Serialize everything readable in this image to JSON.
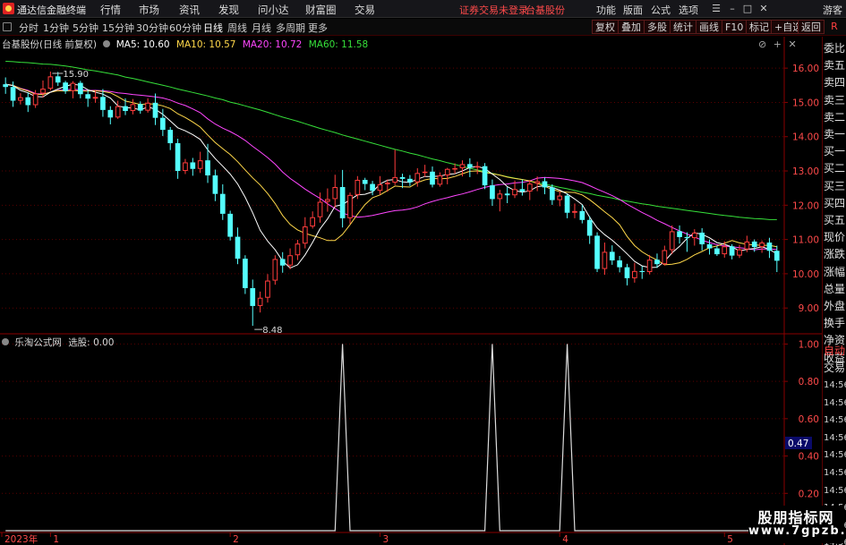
{
  "app": {
    "title": "通达信金融终端"
  },
  "menu": [
    "行情",
    "市场",
    "资讯",
    "发现",
    "问小达",
    "财富圈",
    "交易"
  ],
  "status": {
    "login_warning": "证券交易未登录",
    "stock": "台基股份"
  },
  "right_menu": [
    "功能",
    "版面",
    "公式",
    "选项"
  ],
  "guest": "游客",
  "periods": [
    "分时",
    "1分钟",
    "5分钟",
    "15分钟",
    "30分钟",
    "60分钟",
    "日线",
    "周线",
    "月线",
    "多周期",
    "更多"
  ],
  "active_period": "日线",
  "right_buttons": [
    "复权",
    "叠加",
    "多股",
    "统计",
    "画线",
    "F10",
    "标记",
    "+自选",
    "返回"
  ],
  "corner_label": "R",
  "main_info": {
    "name": "台基股份(日线 前复权)",
    "ma5": "MA5: 10.60",
    "ma10": "MA10: 10.57",
    "ma20": "MA20: 10.72",
    "ma60": "MA60: 11.58"
  },
  "sub_info": {
    "name": "乐淘公式网",
    "value": "选股: 0.00"
  },
  "colors": {
    "up": "#ff3c3c",
    "down": "#54ffff",
    "ma5": "#ffffff",
    "ma10": "#ffd84a",
    "ma20": "#ff46ff",
    "ma60": "#36e03a",
    "signal": "#dcdcdc",
    "axis": "#8a0000",
    "grid": "#5a0000",
    "label_red": "#ff4a4a"
  },
  "side_panel": {
    "top_items": [
      "委比",
      "卖五",
      "卖四",
      "卖三",
      "卖二",
      "卖一",
      "买一",
      "买二",
      "买三",
      "买四",
      "买五",
      "现价",
      "涨跌",
      "涨幅",
      "总量",
      "外盘",
      "换手",
      "净资",
      "收益"
    ],
    "lower_items": [
      "自动",
      "交易"
    ],
    "times": [
      "14:56",
      "14:56",
      "14:56",
      "14:56",
      "14:56",
      "14:56",
      "14:56",
      "14:56",
      "14:56",
      "14:56"
    ]
  },
  "watermark": {
    "top": "股朋指标网",
    "bottom": "www.7gpzb.com"
  },
  "chart_data": [
    {
      "type": "candlestick",
      "ylim": [
        8.3,
        16.5
      ],
      "y_ticks": [
        9.0,
        10.0,
        11.0,
        12.0,
        13.0,
        14.0,
        15.0,
        16.0
      ],
      "y_tick_labels": [
        "9.00",
        "10.00",
        "11.00",
        "12.00",
        "13.00",
        "14.00",
        "15.00",
        "16.00"
      ],
      "x_labels": [
        "2023年",
        "1",
        "2",
        "3",
        "4",
        "5"
      ],
      "x_label_index": [
        0,
        6,
        30,
        50,
        74,
        96
      ],
      "high_label": "15.90",
      "low_label": "8.48",
      "ohlc": [
        [
          15.53,
          15.73,
          15.25,
          15.45
        ],
        [
          15.45,
          15.61,
          14.87,
          15.05
        ],
        [
          15.05,
          15.27,
          14.94,
          15.15
        ],
        [
          15.15,
          15.29,
          14.72,
          14.92
        ],
        [
          14.92,
          15.36,
          14.84,
          15.26
        ],
        [
          15.26,
          15.64,
          15.14,
          15.4
        ],
        [
          15.4,
          15.9,
          15.35,
          15.76
        ],
        [
          15.76,
          15.89,
          15.48,
          15.58
        ],
        [
          15.58,
          15.63,
          15.25,
          15.33
        ],
        [
          15.33,
          15.62,
          15.12,
          15.57
        ],
        [
          15.57,
          15.63,
          15.12,
          15.24
        ],
        [
          15.24,
          15.36,
          14.87,
          15.11
        ],
        [
          15.11,
          15.35,
          14.99,
          15.16
        ],
        [
          15.16,
          15.39,
          14.58,
          14.78
        ],
        [
          14.78,
          14.89,
          14.36,
          14.56
        ],
        [
          14.56,
          15.05,
          14.52,
          14.89
        ],
        [
          14.89,
          15.12,
          14.63,
          14.75
        ],
        [
          14.75,
          15.1,
          14.65,
          14.95
        ],
        [
          14.95,
          15.03,
          14.67,
          14.76
        ],
        [
          14.76,
          15.12,
          14.7,
          14.99
        ],
        [
          14.99,
          15.26,
          14.34,
          14.55
        ],
        [
          14.55,
          14.81,
          14.02,
          14.2
        ],
        [
          14.2,
          14.28,
          13.61,
          13.81
        ],
        [
          13.81,
          13.94,
          12.77,
          13.0
        ],
        [
          13.0,
          13.35,
          12.91,
          13.25
        ],
        [
          13.25,
          13.38,
          12.86,
          13.06
        ],
        [
          13.06,
          13.56,
          12.94,
          13.31
        ],
        [
          13.31,
          13.79,
          12.65,
          12.87
        ],
        [
          12.87,
          13.04,
          12.12,
          12.33
        ],
        [
          12.33,
          12.61,
          11.57,
          11.75
        ],
        [
          11.75,
          11.84,
          10.97,
          11.08
        ],
        [
          11.08,
          11.35,
          10.28,
          10.44
        ],
        [
          10.44,
          10.54,
          9.41,
          9.58
        ],
        [
          9.58,
          9.83,
          8.48,
          9.06
        ],
        [
          9.06,
          9.48,
          8.87,
          9.3
        ],
        [
          9.3,
          9.99,
          9.16,
          9.8
        ],
        [
          9.8,
          10.54,
          9.68,
          10.43
        ],
        [
          10.43,
          10.63,
          10.03,
          10.24
        ],
        [
          10.24,
          10.74,
          10.13,
          10.54
        ],
        [
          10.54,
          10.99,
          10.4,
          10.88
        ],
        [
          10.88,
          11.65,
          10.74,
          11.38
        ],
        [
          11.38,
          11.82,
          11.32,
          11.65
        ],
        [
          11.65,
          12.37,
          11.49,
          12.1
        ],
        [
          12.1,
          12.49,
          11.81,
          12.18
        ],
        [
          12.18,
          12.89,
          11.93,
          12.53
        ],
        [
          12.53,
          13.03,
          11.35,
          11.62
        ],
        [
          11.62,
          12.37,
          11.46,
          12.3
        ],
        [
          12.3,
          12.85,
          12.18,
          12.74
        ],
        [
          12.74,
          12.8,
          12.44,
          12.62
        ],
        [
          12.62,
          12.71,
          12.29,
          12.42
        ],
        [
          12.42,
          12.85,
          12.31,
          12.61
        ],
        [
          12.61,
          12.75,
          12.39,
          12.66
        ],
        [
          12.66,
          13.62,
          12.59,
          12.82
        ],
        [
          12.82,
          12.92,
          12.5,
          12.77
        ],
        [
          12.77,
          12.88,
          12.56,
          12.67
        ],
        [
          12.67,
          13.08,
          12.54,
          12.94
        ],
        [
          12.94,
          13.18,
          12.83,
          12.98
        ],
        [
          12.98,
          13.13,
          12.52,
          12.6
        ],
        [
          12.6,
          12.96,
          12.54,
          12.87
        ],
        [
          12.87,
          13.09,
          12.61,
          13.06
        ],
        [
          13.06,
          13.22,
          12.92,
          13.08
        ],
        [
          13.08,
          13.31,
          12.84,
          13.2
        ],
        [
          13.2,
          13.37,
          12.82,
          13.1
        ],
        [
          13.1,
          13.27,
          12.91,
          13.14
        ],
        [
          13.14,
          13.23,
          12.47,
          12.58
        ],
        [
          12.58,
          12.75,
          11.98,
          12.18
        ],
        [
          12.18,
          12.45,
          11.82,
          12.34
        ],
        [
          12.34,
          12.53,
          12.06,
          12.29
        ],
        [
          12.29,
          12.72,
          12.21,
          12.47
        ],
        [
          12.47,
          12.75,
          12.28,
          12.4
        ],
        [
          12.4,
          12.74,
          12.15,
          12.63
        ],
        [
          12.63,
          12.84,
          12.41,
          12.7
        ],
        [
          12.7,
          12.81,
          12.32,
          12.52
        ],
        [
          12.52,
          12.61,
          12.01,
          12.15
        ],
        [
          12.15,
          12.41,
          11.97,
          12.28
        ],
        [
          12.28,
          12.33,
          11.62,
          11.78
        ],
        [
          11.78,
          12.05,
          11.62,
          11.83
        ],
        [
          11.83,
          12.01,
          11.47,
          11.57
        ],
        [
          11.57,
          11.68,
          10.87,
          11.11
        ],
        [
          11.11,
          11.21,
          10.05,
          10.14
        ],
        [
          10.14,
          10.91,
          9.97,
          10.64
        ],
        [
          10.64,
          10.83,
          10.26,
          10.39
        ],
        [
          10.39,
          10.52,
          10.04,
          10.19
        ],
        [
          10.19,
          10.29,
          9.66,
          9.87
        ],
        [
          9.87,
          10.32,
          9.74,
          10.08
        ],
        [
          10.08,
          10.22,
          9.85,
          10.05
        ],
        [
          10.05,
          10.55,
          9.98,
          10.41
        ],
        [
          10.41,
          10.59,
          10.17,
          10.28
        ],
        [
          10.28,
          10.82,
          10.24,
          10.69
        ],
        [
          10.69,
          11.41,
          10.57,
          11.24
        ],
        [
          11.24,
          11.41,
          10.88,
          11.07
        ],
        [
          11.07,
          11.21,
          10.64,
          11.04
        ],
        [
          11.04,
          11.3,
          10.82,
          11.2
        ],
        [
          11.2,
          11.33,
          10.68,
          10.86
        ],
        [
          10.86,
          11.0,
          10.56,
          10.74
        ],
        [
          10.74,
          10.81,
          10.52,
          10.57
        ],
        [
          10.57,
          10.95,
          10.47,
          10.8
        ],
        [
          10.8,
          10.86,
          10.42,
          10.53
        ],
        [
          10.53,
          10.85,
          10.46,
          10.71
        ],
        [
          10.71,
          11.11,
          10.63,
          10.94
        ],
        [
          10.94,
          11.0,
          10.64,
          10.78
        ],
        [
          10.78,
          10.97,
          10.61,
          10.91
        ],
        [
          10.91,
          11.05,
          10.46,
          10.67
        ],
        [
          10.67,
          10.82,
          10.05,
          10.38
        ]
      ],
      "ma5": [
        15.53,
        15.49,
        15.35,
        15.28,
        15.17,
        15.16,
        15.3,
        15.39,
        15.47,
        15.53,
        15.5,
        15.37,
        15.3,
        15.24,
        15.13,
        14.9,
        14.85,
        14.84,
        14.78,
        14.87,
        14.8,
        14.65,
        14.46,
        14.26,
        14.17,
        14.06,
        13.92,
        13.62,
        13.36,
        13.14,
        12.91,
        12.62,
        12.23,
        11.78,
        11.27,
        10.95,
        10.7,
        10.37,
        10.17,
        10.26,
        10.55,
        10.92,
        11.31,
        11.6,
        11.97,
        12.02,
        12.16,
        12.3,
        12.32,
        12.39,
        12.62,
        12.73,
        12.75,
        12.68,
        12.67,
        12.76,
        12.84,
        12.84,
        12.85,
        12.9,
        12.92,
        13.0,
        13.1,
        13.13,
        13.07,
        12.91,
        12.75,
        12.54,
        12.43,
        12.38,
        12.42,
        12.54,
        12.57,
        12.52,
        12.44,
        12.33,
        12.18,
        12.02,
        11.65,
        11.34,
        11.14,
        10.98,
        10.79,
        10.58,
        10.36,
        10.23,
        10.18,
        10.19,
        10.36,
        10.61,
        10.8,
        11.03,
        11.2,
        11.15,
        11.05,
        10.91,
        10.86,
        10.78,
        10.67,
        10.71,
        10.74,
        10.79,
        10.71,
        10.58
      ],
      "ma10": [
        15.53,
        15.5,
        15.4,
        15.33,
        15.24,
        15.23,
        15.3,
        15.34,
        15.33,
        15.35,
        15.33,
        15.33,
        15.34,
        15.32,
        15.28,
        15.17,
        15.04,
        14.99,
        14.94,
        14.96,
        14.95,
        14.9,
        14.82,
        14.67,
        14.56,
        14.43,
        14.28,
        14.05,
        13.83,
        13.65,
        13.48,
        13.27,
        13.03,
        12.8,
        12.59,
        12.34,
        12.05,
        11.7,
        11.44,
        11.28,
        11.18,
        11.11,
        11.05,
        10.97,
        10.97,
        11.15,
        11.43,
        11.74,
        12.02,
        12.22,
        12.3,
        12.43,
        12.56,
        12.54,
        12.53,
        12.66,
        12.74,
        12.78,
        12.77,
        12.78,
        12.84,
        12.92,
        12.99,
        13.0,
        12.96,
        12.92,
        12.88,
        12.82,
        12.78,
        12.75,
        12.71,
        12.64,
        12.55,
        12.46,
        12.4,
        12.38,
        12.37,
        12.3,
        12.16,
        11.99,
        11.81,
        11.64,
        11.43,
        11.09,
        10.82,
        10.64,
        10.51,
        10.4,
        10.26,
        10.28,
        10.32,
        10.42,
        10.55,
        10.65,
        10.76,
        10.81,
        10.89,
        10.97,
        10.9,
        10.86,
        10.84,
        10.83,
        10.83,
        10.79
      ],
      "ma20": [
        15.53,
        15.5,
        15.41,
        15.35,
        15.26,
        15.24,
        15.3,
        15.35,
        15.37,
        15.38,
        15.37,
        15.35,
        15.35,
        15.34,
        15.32,
        15.28,
        15.26,
        15.23,
        15.21,
        15.19,
        15.16,
        15.13,
        15.07,
        14.98,
        14.91,
        14.81,
        14.7,
        14.52,
        14.37,
        14.25,
        14.15,
        14.03,
        13.89,
        13.72,
        13.56,
        13.39,
        13.2,
        12.97,
        12.78,
        12.63,
        12.47,
        12.33,
        12.2,
        12.04,
        11.9,
        11.77,
        11.7,
        11.65,
        11.67,
        11.7,
        11.75,
        11.8,
        11.84,
        11.86,
        11.89,
        11.95,
        12.04,
        12.11,
        12.17,
        12.22,
        12.28,
        12.33,
        12.39,
        12.46,
        12.52,
        12.57,
        12.6,
        12.62,
        12.65,
        12.67,
        12.71,
        12.79,
        12.81,
        12.8,
        12.78,
        12.75,
        12.71,
        12.66,
        12.57,
        12.47,
        12.38,
        12.28,
        12.17,
        12.03,
        11.91,
        11.79,
        11.68,
        11.56,
        11.46,
        11.35,
        11.25,
        11.16,
        11.07,
        10.98,
        10.91,
        10.85,
        10.81,
        10.79,
        10.76,
        10.73,
        10.7,
        10.72,
        10.72,
        10.71
      ],
      "ma60": [
        16.2,
        16.19,
        16.17,
        16.16,
        16.14,
        16.12,
        16.11,
        16.09,
        16.06,
        16.03,
        15.99,
        15.95,
        15.92,
        15.88,
        15.84,
        15.8,
        15.74,
        15.7,
        15.65,
        15.6,
        15.55,
        15.5,
        15.45,
        15.39,
        15.34,
        15.29,
        15.24,
        15.19,
        15.13,
        15.08,
        15.01,
        14.96,
        14.9,
        14.84,
        14.78,
        14.71,
        14.64,
        14.57,
        14.51,
        14.45,
        14.38,
        14.31,
        14.24,
        14.18,
        14.12,
        14.05,
        13.99,
        13.93,
        13.87,
        13.81,
        13.75,
        13.69,
        13.63,
        13.58,
        13.52,
        13.47,
        13.41,
        13.35,
        13.3,
        13.24,
        13.19,
        13.13,
        13.08,
        13.03,
        12.98,
        12.93,
        12.88,
        12.83,
        12.79,
        12.75,
        12.7,
        12.66,
        12.61,
        12.57,
        12.52,
        12.48,
        12.43,
        12.38,
        12.34,
        12.29,
        12.25,
        12.21,
        12.16,
        12.12,
        12.08,
        12.04,
        12.01,
        11.97,
        11.94,
        11.91,
        11.88,
        11.85,
        11.82,
        11.79,
        11.76,
        11.73,
        11.7,
        11.68,
        11.65,
        11.63,
        11.61,
        11.6,
        11.58,
        11.58
      ]
    },
    {
      "type": "line",
      "ylim": [
        0,
        1.05
      ],
      "y_ticks": [
        0.2,
        0.4,
        0.6,
        0.8,
        1.0
      ],
      "y_tick_labels": [
        "0.20",
        "0.40",
        "0.60",
        "0.80",
        "1.00"
      ],
      "current_label": "0.47",
      "current_value": 0.47,
      "signal_index": [
        45,
        65,
        75
      ]
    }
  ]
}
